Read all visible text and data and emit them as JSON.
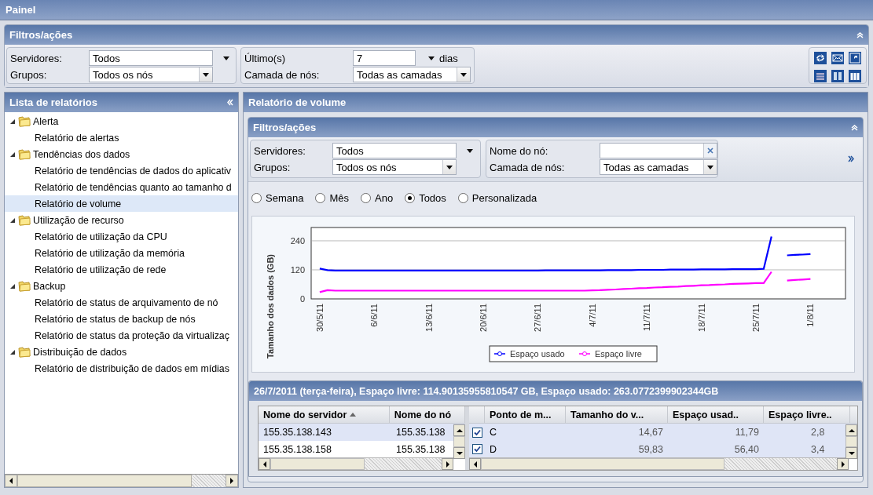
{
  "window": {
    "title": "Painel"
  },
  "filters": {
    "title": "Filtros/ações",
    "fields": [
      {
        "kind": "picker",
        "label": "Servidores:",
        "value": "Todos"
      },
      {
        "kind": "combo",
        "label": "Grupos:",
        "value": "Todos os nós"
      },
      {
        "kind": "spinner",
        "label": "Último(s)",
        "value": "7",
        "unit": "dias"
      },
      {
        "kind": "combo",
        "label": "Camada de nós:",
        "value": "Todas as camadas"
      }
    ]
  },
  "report_list": {
    "title": "Lista de relatórios",
    "items": [
      {
        "label": "Alerta",
        "expanded": true,
        "children": [
          {
            "label": "Relatório de alertas",
            "selected": false
          }
        ]
      },
      {
        "label": "Tendências dos dados",
        "expanded": true,
        "children": [
          {
            "label": "Relatório de tendências de dados do aplicativ",
            "selected": false
          },
          {
            "label": "Relatório de tendências quanto ao tamanho d",
            "selected": false
          },
          {
            "label": "Relatório de volume",
            "selected": true
          }
        ]
      },
      {
        "label": "Utilização de recurso",
        "expanded": true,
        "children": [
          {
            "label": "Relatório de utilização da CPU",
            "selected": false
          },
          {
            "label": "Relatório de utilização da memória",
            "selected": false
          },
          {
            "label": "Relatório de utilização de rede",
            "selected": false
          }
        ]
      },
      {
        "label": "Backup",
        "expanded": true,
        "children": [
          {
            "label": "Relatório de status de arquivamento de nó",
            "selected": false
          },
          {
            "label": "Relatório de status de backup de nós",
            "selected": false
          },
          {
            "label": "Relatório de status da proteção da virtualizaç",
            "selected": false
          }
        ]
      },
      {
        "label": "Distribuição de dados",
        "expanded": true,
        "children": [
          {
            "label": "Relatório de distribuição de dados em mídias",
            "selected": false
          }
        ]
      }
    ]
  },
  "report": {
    "title": "Relatório de volume",
    "filters": {
      "title": "Filtros/ações",
      "fields": [
        {
          "kind": "picker",
          "label": "Servidores:",
          "value": "Todos"
        },
        {
          "kind": "combo",
          "label": "Grupos:",
          "value": "Todos os nós"
        },
        {
          "kind": "search",
          "label": "Nome do nó:"
        },
        {
          "kind": "combo",
          "label": "Camada de nós:",
          "value": "Todas as camadas"
        }
      ]
    },
    "periods": [
      {
        "label": "Semana",
        "selected": false
      },
      {
        "label": "Mês",
        "selected": false
      },
      {
        "label": "Ano",
        "selected": false
      },
      {
        "label": "Todos",
        "selected": true
      },
      {
        "label": "Personalizada",
        "selected": false
      }
    ],
    "chart_data": {
      "type": "line",
      "ylabel": "Tamanho dos dados (GB)",
      "categories": [
        "30/5/11",
        null,
        null,
        null,
        null,
        null,
        null,
        "6/6/11",
        null,
        null,
        null,
        null,
        null,
        null,
        "13/6/11",
        null,
        null,
        null,
        null,
        null,
        null,
        "20/6/11",
        null,
        null,
        null,
        null,
        null,
        null,
        "27/6/11",
        null,
        null,
        null,
        null,
        null,
        null,
        "4/7/11",
        null,
        null,
        null,
        null,
        null,
        null,
        "11/7/11",
        null,
        null,
        null,
        null,
        null,
        null,
        "18/7/11",
        null,
        null,
        null,
        null,
        null,
        null,
        "25/7/11",
        null,
        null,
        null,
        null,
        null,
        null,
        "1/8/11"
      ],
      "ylim": [
        0,
        295
      ],
      "yticks": [
        0,
        120,
        240
      ],
      "legend": "bottom",
      "series": [
        {
          "name": "Espaço usado",
          "color": "#0000ff",
          "values": [
            125,
            119,
            117,
            117,
            117,
            117,
            117,
            117,
            117,
            117,
            117,
            117,
            117,
            117,
            117,
            117,
            117,
            117,
            117,
            117,
            117,
            117,
            117,
            117,
            117,
            117,
            117,
            117,
            117,
            118,
            118,
            118,
            118,
            118,
            118,
            118,
            118,
            119,
            119,
            119,
            119,
            120,
            120,
            120,
            120,
            121,
            121,
            121,
            121,
            122,
            122,
            122,
            122,
            123,
            123,
            123,
            123,
            124,
            258,
            null,
            180,
            182,
            183,
            185
          ]
        },
        {
          "name": "Espaço livre",
          "color": "#ff00ff",
          "values": [
            28,
            36,
            34,
            34,
            34,
            34,
            34,
            34,
            34,
            34,
            34,
            34,
            34,
            34,
            34,
            34,
            34,
            34,
            34,
            34,
            34,
            34,
            34,
            34,
            34,
            34,
            34,
            34,
            34,
            34,
            34,
            34,
            34,
            34,
            34,
            35,
            36,
            38,
            39,
            41,
            42,
            44,
            45,
            47,
            48,
            50,
            51,
            53,
            54,
            56,
            57,
            59,
            60,
            62,
            63,
            64,
            65,
            65,
            112,
            null,
            76,
            78,
            80,
            82
          ]
        }
      ]
    },
    "details": {
      "title": "26/7/2011 (terça-feira), Espaço livre: 114.90135955810547 GB, Espaço usado: 263.0772399902344GB",
      "locked_columns": [
        {
          "label": "Nome do servidor",
          "sorted": true
        },
        {
          "label": "Nome do nó",
          "sorted": false
        }
      ],
      "columns": [
        {
          "label": "Ponto de m...",
          "sorted": false
        },
        {
          "label": "Tamanho do v...",
          "sorted": false
        },
        {
          "label": "Espaço usad..",
          "sorted": false
        },
        {
          "label": "Espaço livre..",
          "sorted": false
        }
      ],
      "rows": [
        {
          "server": "155.35.138.143",
          "node": "155.35.138",
          "checked": true,
          "mount": "C",
          "size": "14,67",
          "used": "11,79",
          "free": "2,8",
          "selected": true
        },
        {
          "server": "155.35.138.158",
          "node": "155.35.138",
          "checked": true,
          "mount": "D",
          "size": "59,83",
          "used": "56,40",
          "free": "3,4",
          "selected": false
        }
      ]
    }
  }
}
